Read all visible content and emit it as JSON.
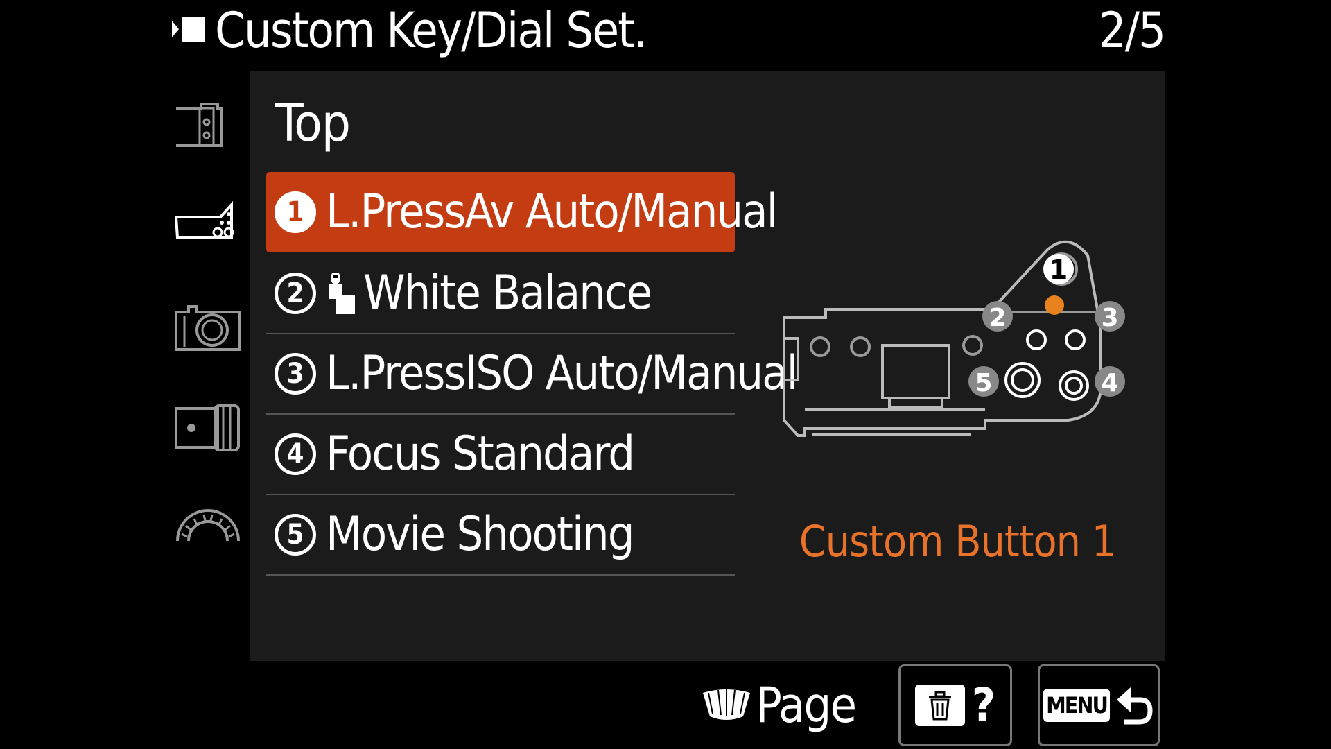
{
  "header": {
    "title": "Custom Key/Dial Set.",
    "page_counter": "2/5"
  },
  "tabs": [
    {
      "icon": "camera-rear-tab-icon"
    },
    {
      "icon": "camera-top-tab-icon",
      "active": true
    },
    {
      "icon": "camera-front-tab-icon"
    },
    {
      "icon": "lens-tab-icon"
    },
    {
      "icon": "dial-tab-icon"
    }
  ],
  "section": {
    "title": "Top"
  },
  "menu": {
    "items": [
      {
        "number": "1",
        "label": "L.PressAv Auto/Manual",
        "selected": true
      },
      {
        "number": "2",
        "label": "White Balance",
        "icon": "white-balance-icon"
      },
      {
        "number": "3",
        "label": "L.PressISO Auto/Manual"
      },
      {
        "number": "4",
        "label": "Focus Standard"
      },
      {
        "number": "5",
        "label": "Movie Shooting"
      }
    ]
  },
  "diagram": {
    "callouts": [
      "1",
      "2",
      "3",
      "4",
      "5"
    ],
    "highlight_color": "#e8821e"
  },
  "custom_button_label": "Custom Button 1",
  "footer": {
    "page_label": "Page",
    "help_label": "?",
    "menu_label": "MENU"
  },
  "colors": {
    "accent": "#c43c12",
    "label_orange": "#e8722a",
    "panel": "#1b1b1b"
  }
}
